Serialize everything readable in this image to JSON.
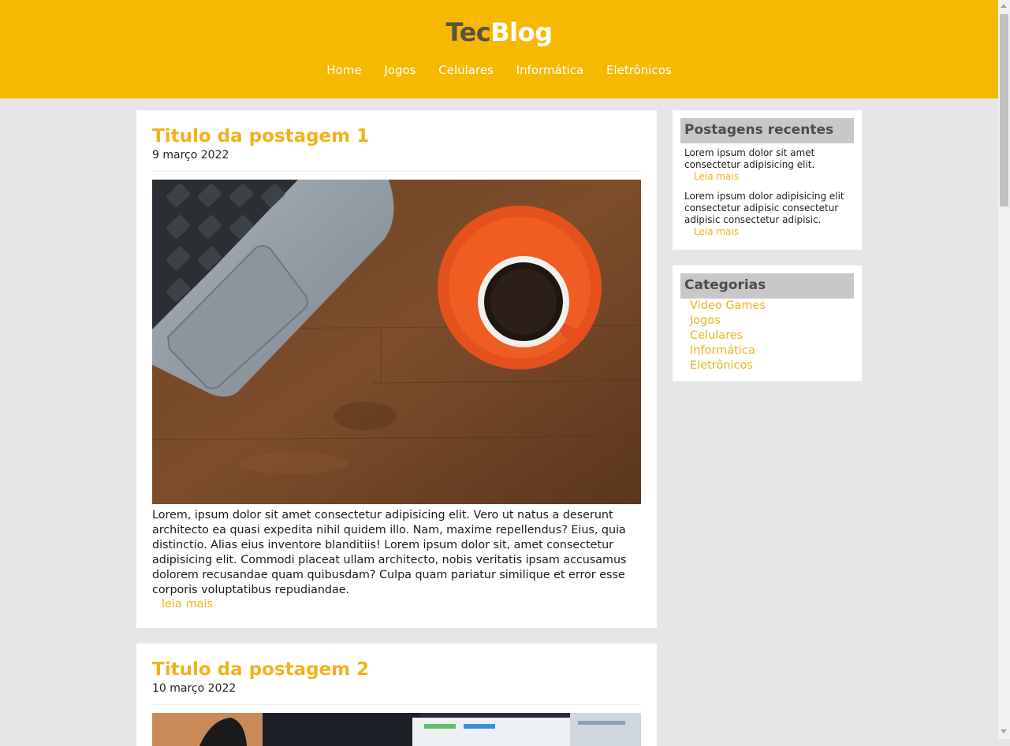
{
  "header": {
    "logo_part1": "Tec",
    "logo_part2": "Blog",
    "nav": [
      "Home",
      "Jogos",
      "Celulares",
      "Informática",
      "Eletrônicos"
    ]
  },
  "posts": [
    {
      "title": "Titulo da postagem 1",
      "date": "9 março 2022",
      "body": "Lorem, ipsum dolor sit amet consectetur adipisicing elit. Vero ut natus a deserunt architecto ea quasi expedita nihil quidem illo. Nam, maxime repellendus? Eius, quia distinctio. Alias eius inventore blanditiis! Lorem ipsum dolor sit, amet consectetur adipisicing elit. Commodi placeat ullam architecto, nobis veritatis ipsam accusamus dolorem recusandae quam quibusdam? Culpa quam pariatur similique et error esse corporis voluptatibus repudiandae.",
      "read_more": "leia mais"
    },
    {
      "title": "Titulo da postagem 2",
      "date": "10 março 2022"
    }
  ],
  "sidebar": {
    "recent": {
      "heading": "Postagens recentes",
      "items": [
        {
          "text": "Lorem ipsum dolor sit amet consectetur adipisicing elit.",
          "link": "Leia mais"
        },
        {
          "text": "Lorem ipsum dolor adipisicing elit consectetur adipisic consectetur adipisic consectetur adipisic.",
          "link": "Leia mais"
        }
      ]
    },
    "categories": {
      "heading": "Categorias",
      "items": [
        "Video Games",
        "Jogos",
        "Celulares",
        "Informática",
        "Eletrônicos"
      ]
    }
  },
  "colors": {
    "header_bg": "#f6b800",
    "accent": "#f2b21c",
    "page_bg": "#e6e6e6"
  }
}
